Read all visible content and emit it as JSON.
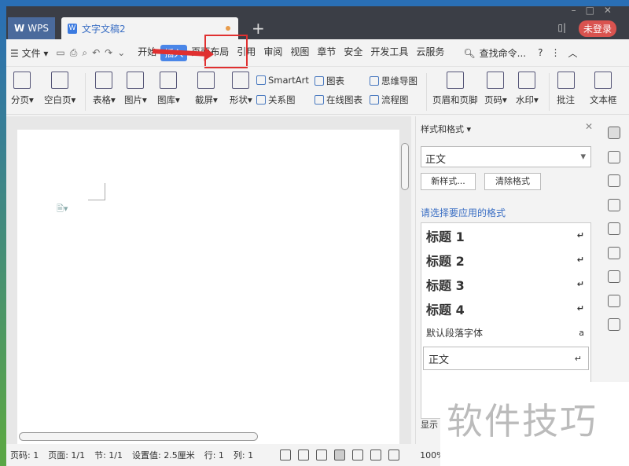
{
  "titlebar": {
    "wps_tab": "WPS",
    "doc_tab": "文字文稿2",
    "new_tab": "+",
    "login": "未登录"
  },
  "menubar": {
    "file": "☰ 文件 ▾",
    "items": [
      "开始",
      "插入",
      "页面布局",
      "引用",
      "审阅",
      "视图",
      "章节",
      "安全",
      "开发工具",
      "云服务"
    ],
    "active": "插入",
    "search": "查找命令...",
    "help": "?"
  },
  "ribbon": {
    "large": [
      "分页▾",
      "空白页▾",
      "表格▾",
      "图片▾",
      "图库▾",
      "截屏▾",
      "形状▾",
      "页眉和页脚",
      "页码▾",
      "水印▾",
      "批注",
      "文本框"
    ],
    "small": [
      "SmartArt",
      "关系图",
      "图表",
      "在线图表",
      "思维导图",
      "流程图"
    ]
  },
  "panel": {
    "title": "样式和格式 ▾",
    "current_style": "正文",
    "new_style": "新样式...",
    "clear_format": "清除格式",
    "prompt": "请选择要应用的格式",
    "styles": [
      {
        "name": "标题  1",
        "mark": "↵"
      },
      {
        "name": "标题  2",
        "mark": "↵"
      },
      {
        "name": "标题  3",
        "mark": "↵"
      },
      {
        "name": "标题  4",
        "mark": "↵"
      },
      {
        "name": "默认段落字体",
        "mark": "a"
      },
      {
        "name": "正文",
        "mark": "↵"
      }
    ],
    "show": "显示"
  },
  "status": {
    "page_num": "页码: 1",
    "pages": "页面: 1/1",
    "section": "节: 1/1",
    "setting": "设置值: 2.5厘米",
    "row": "行: 1",
    "col": "列: 1",
    "zoom": "100%"
  },
  "watermark": "软件技巧",
  "colors": {
    "accent": "#4a86e8",
    "highlight": "#e03030",
    "login": "#d9534f"
  }
}
